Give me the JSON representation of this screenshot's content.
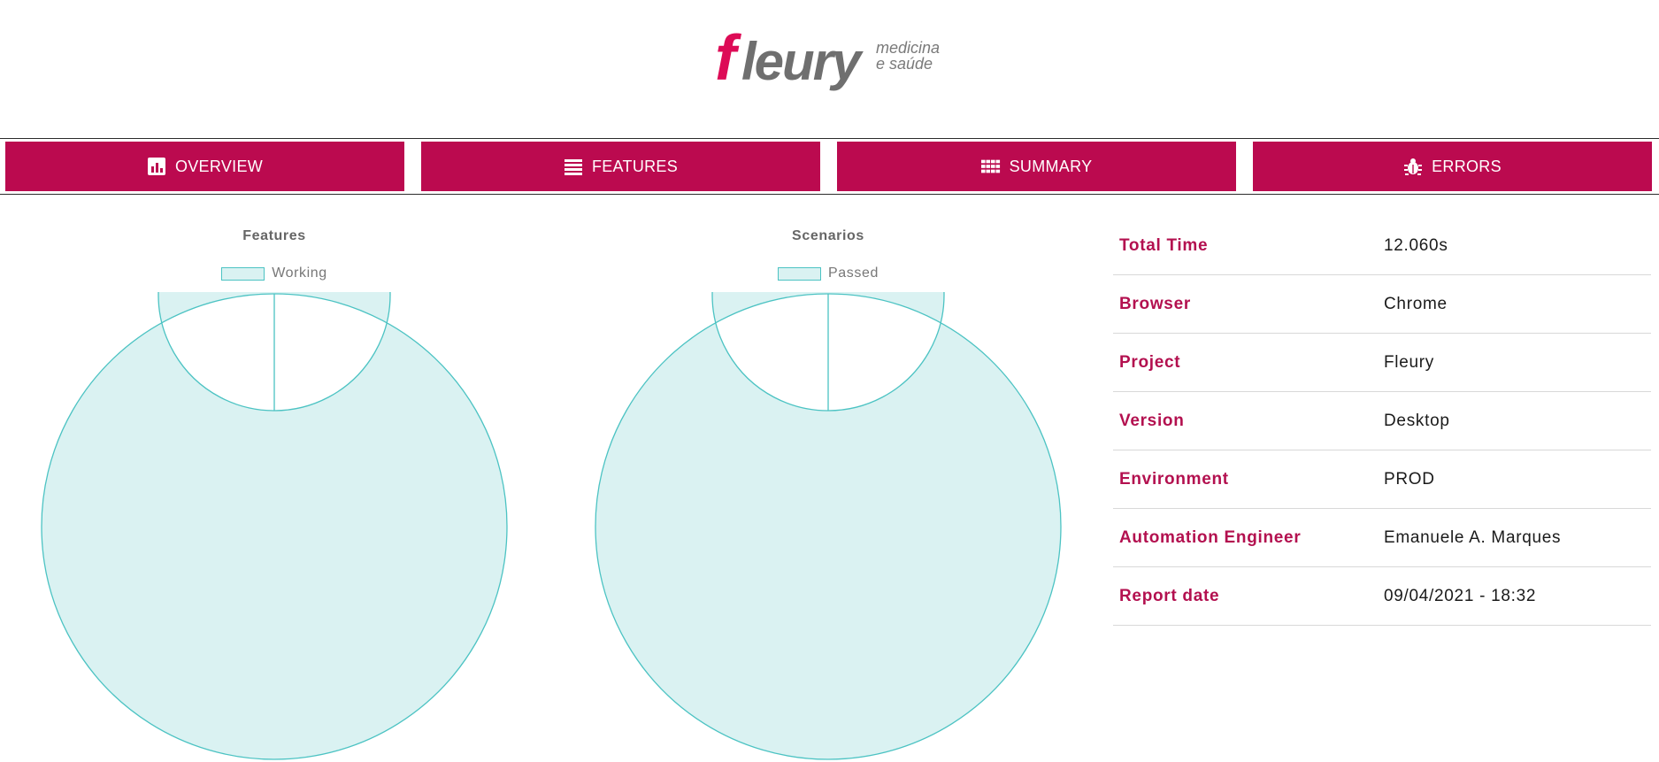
{
  "brand": {
    "name": "fleury",
    "tagline_line1": "medicina",
    "tagline_line2": "e saúde",
    "accent_color": "#bb0a4f"
  },
  "nav": [
    {
      "label": "OVERVIEW",
      "icon": "bar-chart-icon"
    },
    {
      "label": "FEATURES",
      "icon": "list-icon"
    },
    {
      "label": "SUMMARY",
      "icon": "grid-icon"
    },
    {
      "label": "ERRORS",
      "icon": "bug-icon"
    }
  ],
  "charts": {
    "features": {
      "title": "Features",
      "legend": "Working"
    },
    "scenarios": {
      "title": "Scenarios",
      "legend": "Passed"
    }
  },
  "chart_data": [
    {
      "type": "pie",
      "title": "Features",
      "categories": [
        "Working"
      ],
      "values": [
        1
      ],
      "colors": [
        "#daf2f2"
      ],
      "legend_position": "top"
    },
    {
      "type": "pie",
      "title": "Scenarios",
      "categories": [
        "Passed"
      ],
      "values": [
        1
      ],
      "colors": [
        "#daf2f2"
      ],
      "legend_position": "top"
    }
  ],
  "info": [
    {
      "key": "Total Time",
      "value": "12.060s"
    },
    {
      "key": "Browser",
      "value": "Chrome"
    },
    {
      "key": "Project",
      "value": "Fleury"
    },
    {
      "key": "Version",
      "value": "Desktop"
    },
    {
      "key": "Environment",
      "value": "PROD"
    },
    {
      "key": "Automation Engineer",
      "value": "Emanuele A. Marques"
    },
    {
      "key": "Report date",
      "value": "09/04/2021 - 18:32"
    }
  ]
}
